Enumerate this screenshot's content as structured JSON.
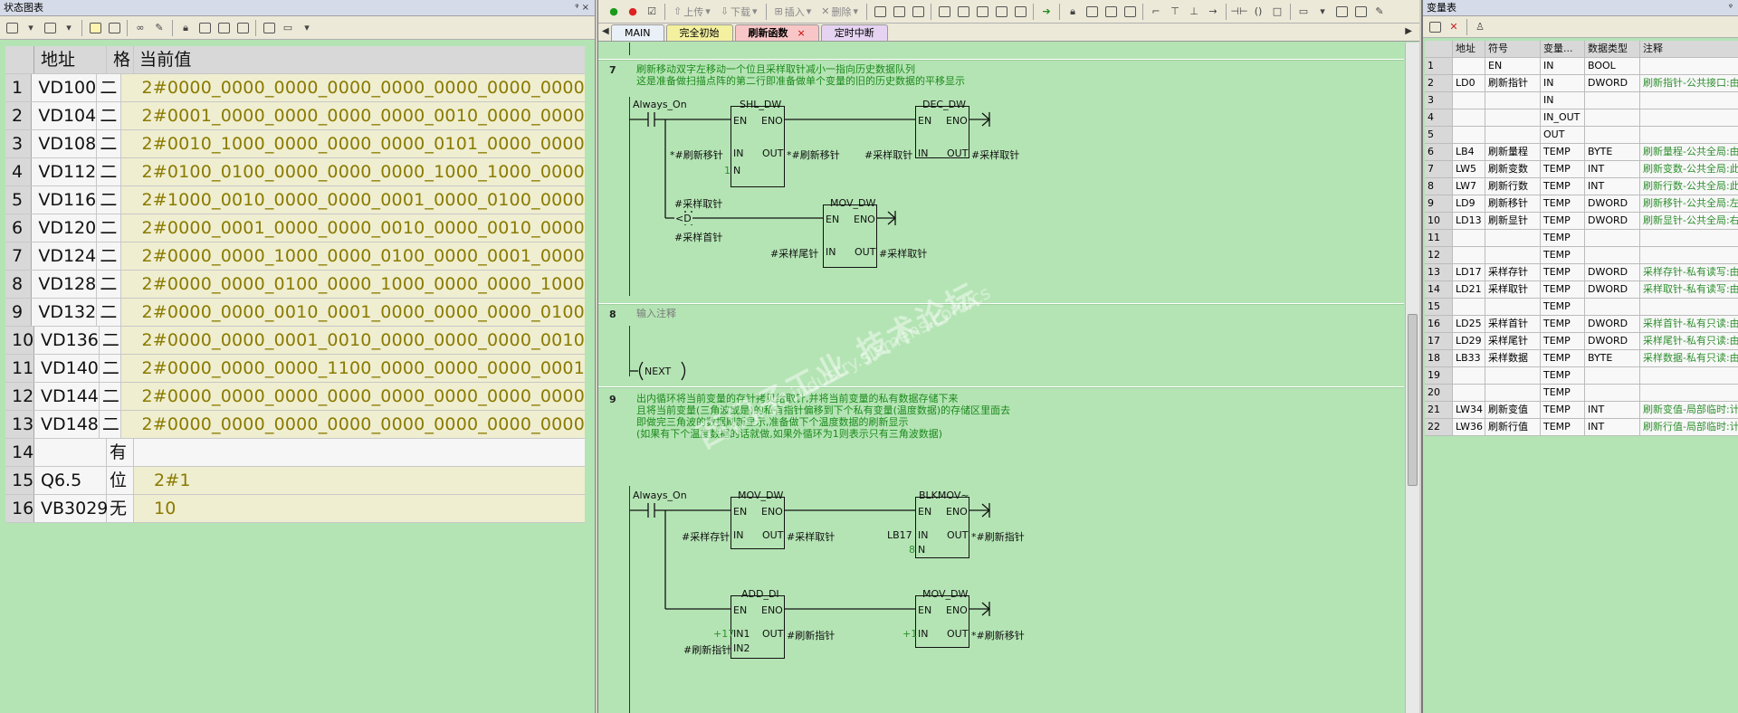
{
  "left_panel": {
    "title": "状态图表",
    "pin": "ᵠ ×",
    "columns": [
      "",
      "地址",
      "格",
      "当前值"
    ],
    "rows": [
      {
        "n": "1",
        "addr": "VD100",
        "fmt": "二",
        "val": "2#0000_0000_0000_0000_0000_0000_0000_0000"
      },
      {
        "n": "2",
        "addr": "VD104",
        "fmt": "二",
        "val": "2#0001_0000_0000_0000_0000_0010_0000_0000"
      },
      {
        "n": "3",
        "addr": "VD108",
        "fmt": "二",
        "val": "2#0010_1000_0000_0000_0000_0101_0000_0000"
      },
      {
        "n": "4",
        "addr": "VD112",
        "fmt": "二",
        "val": "2#0100_0100_0000_0000_0000_1000_1000_0000"
      },
      {
        "n": "5",
        "addr": "VD116",
        "fmt": "二",
        "val": "2#1000_0010_0000_0000_0001_0000_0100_0000"
      },
      {
        "n": "6",
        "addr": "VD120",
        "fmt": "二",
        "val": "2#0000_0001_0000_0000_0010_0000_0010_0000"
      },
      {
        "n": "7",
        "addr": "VD124",
        "fmt": "二",
        "val": "2#0000_0000_1000_0000_0100_0000_0001_0000"
      },
      {
        "n": "8",
        "addr": "VD128",
        "fmt": "二",
        "val": "2#0000_0000_0100_0000_1000_0000_0000_1000"
      },
      {
        "n": "9",
        "addr": "VD132",
        "fmt": "二",
        "val": "2#0000_0000_0010_0001_0000_0000_0000_0100"
      },
      {
        "n": "10",
        "addr": "VD136",
        "fmt": "二",
        "val": "2#0000_0000_0001_0010_0000_0000_0000_0010"
      },
      {
        "n": "11",
        "addr": "VD140",
        "fmt": "二",
        "val": "2#0000_0000_0000_1100_0000_0000_0000_0001"
      },
      {
        "n": "12",
        "addr": "VD144",
        "fmt": "二",
        "val": "2#0000_0000_0000_0000_0000_0000_0000_0000"
      },
      {
        "n": "13",
        "addr": "VD148",
        "fmt": "二",
        "val": "2#0000_0000_0000_0000_0000_0000_0000_0000"
      },
      {
        "n": "14",
        "addr": "",
        "fmt": "有",
        "val": ""
      },
      {
        "n": "15",
        "addr": "Q6.5",
        "fmt": "位",
        "val": "2#1"
      },
      {
        "n": "16",
        "addr": "VB3029",
        "fmt": "无",
        "val": "10"
      }
    ]
  },
  "editor": {
    "toolbar": {
      "upload": "上传",
      "download": "下载",
      "insert": "插入",
      "delete": "删除"
    },
    "tabs": [
      {
        "label": "MAIN",
        "cls": "main"
      },
      {
        "label": "完全初始",
        "cls": "init"
      },
      {
        "label": "刷新函数",
        "cls": "cur",
        "close": "×"
      },
      {
        "label": "定时中断",
        "cls": "timer"
      }
    ],
    "networks": {
      "n7": {
        "num": "7",
        "comment1": "刷新移动双字左移动一个位且采样取针减小一指向历史数据队列",
        "comment2": "这是准备做扫描点阵的第二行即准备做单个变量的旧的历史数据的平移显示"
      },
      "n8": {
        "num": "8",
        "comment": "输入注释",
        "coil": "NEXT"
      },
      "n9": {
        "num": "9",
        "comment1": "出内循环将当前变量的存针拷贝给取针,并将当前变量的私有数据存储下来",
        "comment2": "且将当前变量(三角波或是)的私有指针偏移到下个私有变量(温度数据)的存储区里面去",
        "comment3": "即做完三角波的数据刷新显示,准备做下个温度数据的刷新显示",
        "comment4": "(如果有下个温度数据的话就做,如果外循环为1则表示只有三角波数据)"
      }
    },
    "labels": {
      "always_on": "Always_On",
      "shl": "SHL_DW",
      "dec": "DEC_DW",
      "mov": "MOV_DW",
      "blk": "BLKMOV~",
      "add": "ADD_DI",
      "en": "EN",
      "eno": "ENO",
      "in": "IN",
      "out": "OUT",
      "n": "N",
      "in1": "IN1",
      "in2": "IN2",
      "refresh_shift": "#刷新移针",
      "sample_take": "#采样取针",
      "sample_head": "#采样首针",
      "sample_tail": "#采样尾针",
      "sample_store": "#采样存针",
      "refresh_ptr": "#刷新指针",
      "lt_d": "<D",
      "one": "1",
      "eight": "8",
      "lb17": "LB17",
      "p17": "+17",
      "p1": "+1",
      "refresh_shift_out": "*#刷新移针",
      "refresh_ptr_out": "*#刷新指针"
    },
    "watermark": {
      "cn": "西门子工业 技术论坛",
      "url": "www.ad.industry.siemens.com/cs"
    }
  },
  "right_panel": {
    "title": "变量表",
    "columns": [
      "",
      "地址",
      "符号",
      "变量...",
      "数据类型",
      "注释"
    ],
    "rows": [
      {
        "n": "1",
        "addr": "",
        "sym": "EN",
        "var": "IN",
        "type": "BOOL",
        "cmt": ""
      },
      {
        "n": "2",
        "addr": "LD0",
        "sym": "刷新指针",
        "var": "IN",
        "type": "DWORD",
        "cmt": "刷新指针-公共接口:由"
      },
      {
        "n": "3",
        "addr": "",
        "sym": "",
        "var": "IN",
        "type": "",
        "cmt": ""
      },
      {
        "n": "4",
        "addr": "",
        "sym": "",
        "var": "IN_OUT",
        "type": "",
        "cmt": ""
      },
      {
        "n": "5",
        "addr": "",
        "sym": "",
        "var": "OUT",
        "type": "",
        "cmt": ""
      },
      {
        "n": "6",
        "addr": "LB4",
        "sym": "刷新量程",
        "var": "TEMP",
        "type": "BYTE",
        "cmt": "刷新量程-公共全局:由"
      },
      {
        "n": "7",
        "addr": "LW5",
        "sym": "刷新变数",
        "var": "TEMP",
        "type": "INT",
        "cmt": "刷新变数-公共全局:此"
      },
      {
        "n": "8",
        "addr": "LW7",
        "sym": "刷新行数",
        "var": "TEMP",
        "type": "INT",
        "cmt": "刷新行数-公共全局:此"
      },
      {
        "n": "9",
        "addr": "LD9",
        "sym": "刷新移针",
        "var": "TEMP",
        "type": "DWORD",
        "cmt": "刷新移针-公共全局:左"
      },
      {
        "n": "10",
        "addr": "LD13",
        "sym": "刷新显针",
        "var": "TEMP",
        "type": "DWORD",
        "cmt": "刷新显针-公共全局:右"
      },
      {
        "n": "11",
        "addr": "",
        "sym": "",
        "var": "TEMP",
        "type": "",
        "cmt": ""
      },
      {
        "n": "12",
        "addr": "",
        "sym": "",
        "var": "TEMP",
        "type": "",
        "cmt": ""
      },
      {
        "n": "13",
        "addr": "LD17",
        "sym": "采样存针",
        "var": "TEMP",
        "type": "DWORD",
        "cmt": "采样存针-私有读写:由"
      },
      {
        "n": "14",
        "addr": "LD21",
        "sym": "采样取针",
        "var": "TEMP",
        "type": "DWORD",
        "cmt": "采样取针-私有读写:由"
      },
      {
        "n": "15",
        "addr": "",
        "sym": "",
        "var": "TEMP",
        "type": "",
        "cmt": ""
      },
      {
        "n": "16",
        "addr": "LD25",
        "sym": "采样首针",
        "var": "TEMP",
        "type": "DWORD",
        "cmt": "采样首针-私有只读:由"
      },
      {
        "n": "17",
        "addr": "LD29",
        "sym": "采样尾针",
        "var": "TEMP",
        "type": "DWORD",
        "cmt": "采样尾针-私有只读:由"
      },
      {
        "n": "18",
        "addr": "LB33",
        "sym": "采样数据",
        "var": "TEMP",
        "type": "BYTE",
        "cmt": "采样数据-私有只读:由"
      },
      {
        "n": "19",
        "addr": "",
        "sym": "",
        "var": "TEMP",
        "type": "",
        "cmt": ""
      },
      {
        "n": "20",
        "addr": "",
        "sym": "",
        "var": "TEMP",
        "type": "",
        "cmt": ""
      },
      {
        "n": "21",
        "addr": "LW34",
        "sym": "刷新变值",
        "var": "TEMP",
        "type": "INT",
        "cmt": "刷新变值-局部临时:计"
      },
      {
        "n": "22",
        "addr": "LW36",
        "sym": "刷新行值",
        "var": "TEMP",
        "type": "INT",
        "cmt": "刷新行值-局部临时:计"
      }
    ]
  }
}
